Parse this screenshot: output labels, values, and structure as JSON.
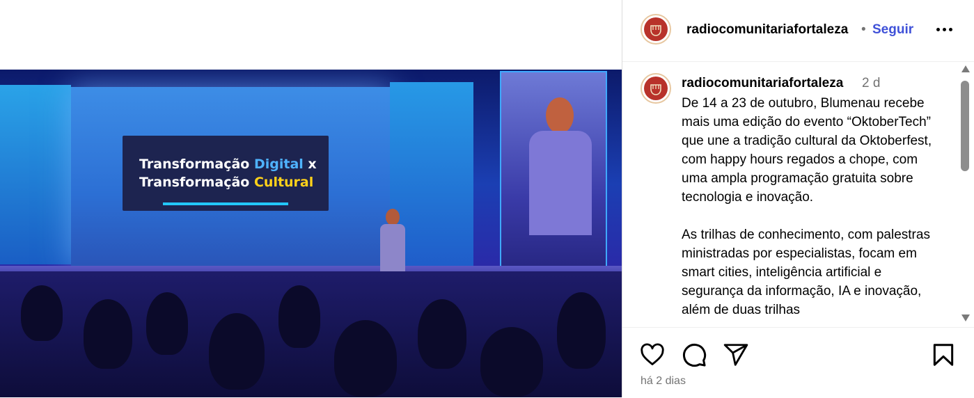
{
  "post": {
    "slide": {
      "line1_a": "Transformação ",
      "line1_b": "Digital",
      "line1_c": " x",
      "line2_a": "Transformação ",
      "line2_b": "Cultural"
    }
  },
  "header": {
    "username": "radiocomunitariafortaleza",
    "separator": "•",
    "follow_label": "Seguir",
    "more_icon": "more-horizontal-icon"
  },
  "comment": {
    "username": "radiocomunitariafortaleza",
    "time": "2 d",
    "caption": "De 14 a 23 de outubro, Blumenau recebe mais uma edição do evento “OktoberTech” que une a tradição cultural da Oktoberfest, com happy hours regados a chope, com uma ampla programação gratuita sobre tecnologia e inovação.\n\nAs trilhas de conhecimento, com palestras ministradas por especialistas, focam em smart cities, inteligência artificial e segurança da informação, IA e inovação, além de duas trilhas"
  },
  "actions": {
    "icons": [
      "heart-icon",
      "comment-icon",
      "share-icon",
      "bookmark-icon"
    ],
    "time_ago": "há 2 dias"
  },
  "colors": {
    "follow": "#3f51d8",
    "muted": "#737373",
    "avatar_red": "#b8322a"
  }
}
